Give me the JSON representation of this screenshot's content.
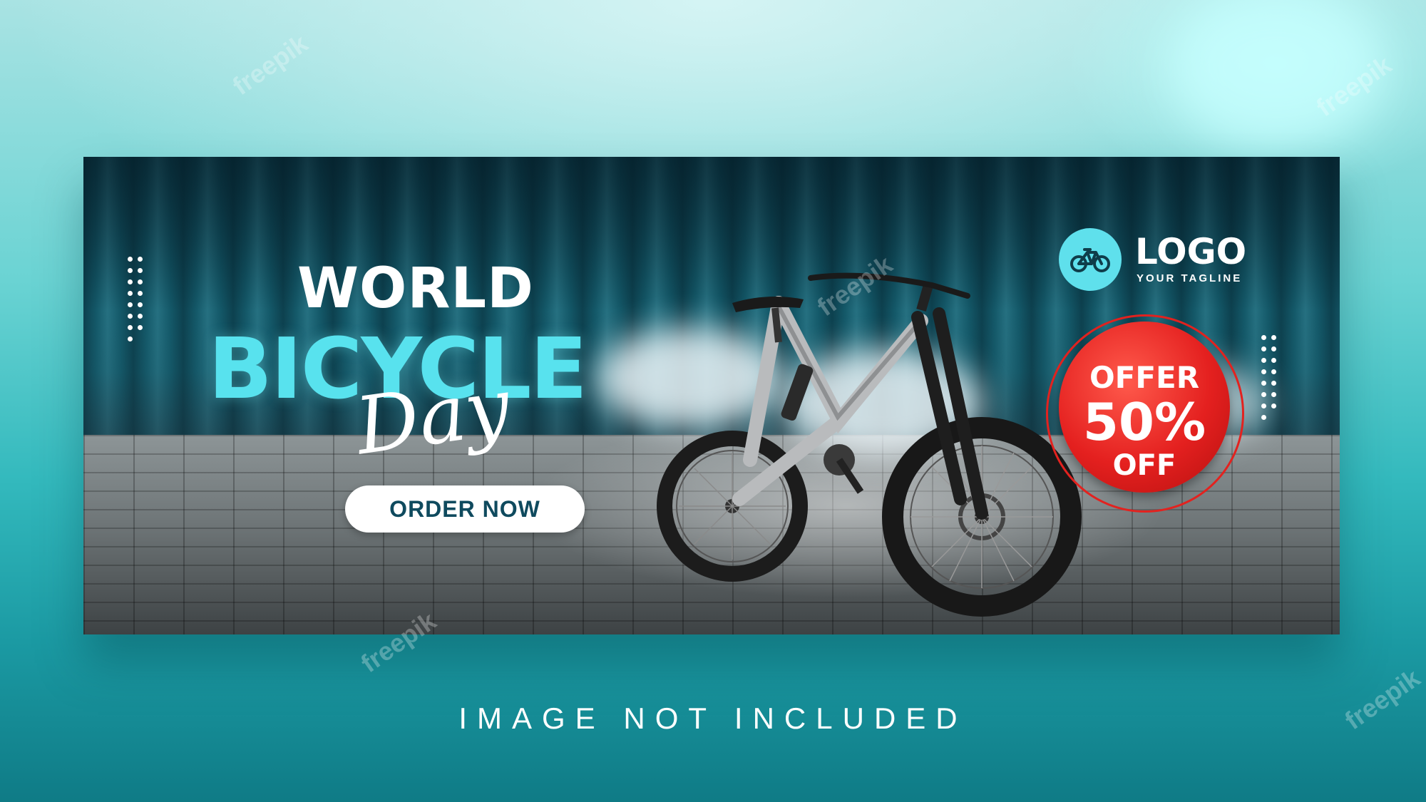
{
  "banner": {
    "headline_line1": "WORLD",
    "headline_line2": "BICYCLE",
    "headline_line3": "Day",
    "cta_label": "ORDER NOW"
  },
  "logo": {
    "name": "LOGO",
    "tagline": "YOUR TAGLINE",
    "icon": "bicycle-icon"
  },
  "offer": {
    "line1": "OFFER",
    "line2": "50%",
    "line3": "OFF"
  },
  "footer": {
    "note": "IMAGE NOT INCLUDED"
  },
  "watermark": {
    "text": "freepik"
  },
  "colors": {
    "accent_cyan": "#58e2ee",
    "offer_red": "#e4201f",
    "cta_text": "#0f4a5e"
  }
}
